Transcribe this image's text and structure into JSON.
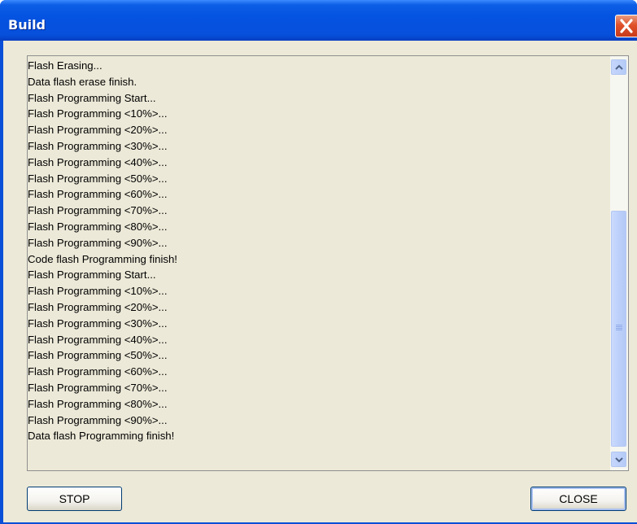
{
  "window": {
    "title": "Build"
  },
  "log": {
    "lines": [
      "Flash Erasing...",
      "Data flash erase finish.",
      "Flash Programming Start...",
      "Flash Programming <10%>...",
      "Flash Programming <20%>...",
      "Flash Programming <30%>...",
      "Flash Programming <40%>...",
      "Flash Programming <50%>...",
      "Flash Programming <60%>...",
      "Flash Programming <70%>...",
      "Flash Programming <80%>...",
      "Flash Programming <90%>...",
      "Code flash Programming finish!",
      "Flash Programming Start...",
      "Flash Programming <10%>...",
      "Flash Programming <20%>...",
      "Flash Programming <30%>...",
      "Flash Programming <40%>...",
      "Flash Programming <50%>...",
      "Flash Programming <60%>...",
      "Flash Programming <70%>...",
      "Flash Programming <80%>...",
      "Flash Programming <90%>...",
      "Data flash Programming finish!"
    ]
  },
  "buttons": {
    "stop_label": "STOP",
    "close_label": "CLOSE"
  },
  "colors": {
    "titlebar": "#0553e1",
    "dialog_bg": "#ece9d8",
    "close_button": "#e0512a"
  },
  "icons": {
    "close": "close-x-icon",
    "scroll_up": "chevron-up-icon",
    "scroll_down": "chevron-down-icon"
  }
}
